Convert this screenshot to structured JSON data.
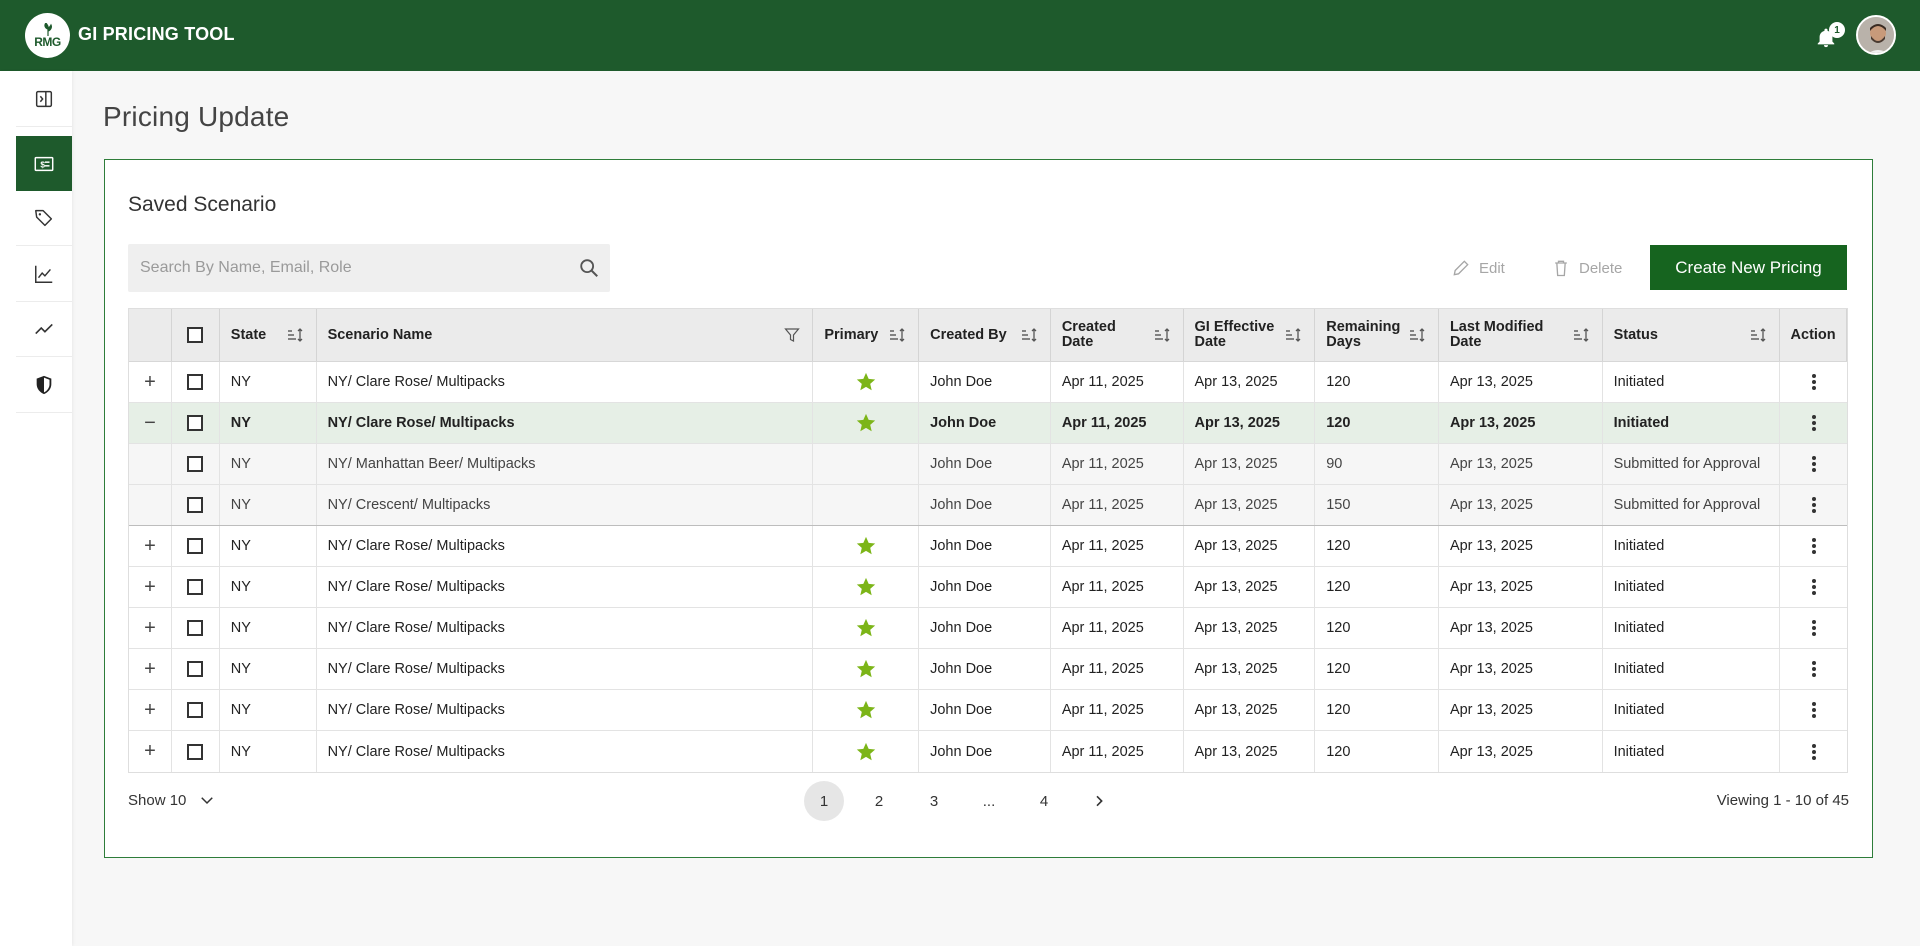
{
  "app": {
    "logo_text": "RMG",
    "title": "GI PRICING TOOL",
    "notification_count": "1"
  },
  "sidebar": {
    "items": [
      {
        "icon": "collapse-sidebar-icon",
        "active": false
      },
      {
        "icon": "pricing-icon",
        "active": true
      },
      {
        "icon": "tag-icon",
        "active": false
      },
      {
        "icon": "chart-icon",
        "active": false
      },
      {
        "icon": "trend-icon",
        "active": false
      },
      {
        "icon": "shield-icon",
        "active": false
      }
    ]
  },
  "page": {
    "title": "Pricing Update"
  },
  "panel": {
    "title": "Saved Scenario",
    "search_placeholder": "Search By Name, Email, Role",
    "edit_label": "Edit",
    "delete_label": "Delete",
    "create_label": "Create New Pricing"
  },
  "table": {
    "headers": {
      "state": "State",
      "scenario_name": "Scenario Name",
      "primary": "Primary",
      "created_by": "Created By",
      "created_date": "Created Date",
      "effective_date": "GI Effective Date",
      "remaining_days": "Remaining Days",
      "last_modified": "Last Modified Date",
      "status": "Status",
      "action": "Action"
    },
    "rows": [
      {
        "expander": "+",
        "kind": "parent",
        "state": "NY",
        "name": "NY/ Clare Rose/ Multipacks",
        "primary": true,
        "created_by": "John Doe",
        "created": "Apr 11, 2025",
        "effective": "Apr 13, 2025",
        "remaining": "120",
        "modified": "Apr 13, 2025",
        "status": "Initiated"
      },
      {
        "expander": "−",
        "kind": "expanded",
        "state": "NY",
        "name": "NY/ Clare Rose/ Multipacks",
        "primary": true,
        "created_by": "John Doe",
        "created": "Apr 11, 2025",
        "effective": "Apr 13, 2025",
        "remaining": "120",
        "modified": "Apr 13, 2025",
        "status": "Initiated"
      },
      {
        "expander": "",
        "kind": "child",
        "state": "NY",
        "name": "NY/ Manhattan Beer/ Multipacks",
        "primary": false,
        "created_by": "John Doe",
        "created": "Apr 11, 2025",
        "effective": "Apr 13, 2025",
        "remaining": "90",
        "modified": "Apr 13, 2025",
        "status": "Submitted for Approval"
      },
      {
        "expander": "",
        "kind": "child last",
        "state": "NY",
        "name": "NY/ Crescent/ Multipacks",
        "primary": false,
        "created_by": "John Doe",
        "created": "Apr 11, 2025",
        "effective": "Apr 13, 2025",
        "remaining": "150",
        "modified": "Apr 13, 2025",
        "status": "Submitted for Approval"
      },
      {
        "expander": "+",
        "kind": "parent",
        "state": "NY",
        "name": "NY/ Clare Rose/ Multipacks",
        "primary": true,
        "created_by": "John Doe",
        "created": "Apr 11, 2025",
        "effective": "Apr 13, 2025",
        "remaining": "120",
        "modified": "Apr 13, 2025",
        "status": "Initiated"
      },
      {
        "expander": "+",
        "kind": "parent",
        "state": "NY",
        "name": "NY/ Clare Rose/ Multipacks",
        "primary": true,
        "created_by": "John Doe",
        "created": "Apr 11, 2025",
        "effective": "Apr 13, 2025",
        "remaining": "120",
        "modified": "Apr 13, 2025",
        "status": "Initiated"
      },
      {
        "expander": "+",
        "kind": "parent",
        "state": "NY",
        "name": "NY/ Clare Rose/ Multipacks",
        "primary": true,
        "created_by": "John Doe",
        "created": "Apr 11, 2025",
        "effective": "Apr 13, 2025",
        "remaining": "120",
        "modified": "Apr 13, 2025",
        "status": "Initiated"
      },
      {
        "expander": "+",
        "kind": "parent",
        "state": "NY",
        "name": "NY/ Clare Rose/ Multipacks",
        "primary": true,
        "created_by": "John Doe",
        "created": "Apr 11, 2025",
        "effective": "Apr 13, 2025",
        "remaining": "120",
        "modified": "Apr 13, 2025",
        "status": "Initiated"
      },
      {
        "expander": "+",
        "kind": "parent",
        "state": "NY",
        "name": "NY/ Clare Rose/ Multipacks",
        "primary": true,
        "created_by": "John Doe",
        "created": "Apr 11, 2025",
        "effective": "Apr 13, 2025",
        "remaining": "120",
        "modified": "Apr 13, 2025",
        "status": "Initiated"
      },
      {
        "expander": "+",
        "kind": "parent",
        "state": "NY",
        "name": "NY/ Clare Rose/ Multipacks",
        "primary": true,
        "created_by": "John Doe",
        "created": "Apr 11, 2025",
        "effective": "Apr 13, 2025",
        "remaining": "120",
        "modified": "Apr 13, 2025",
        "status": "Initiated"
      }
    ]
  },
  "footer": {
    "show_label": "Show 10",
    "pages": [
      "1",
      "2",
      "3",
      "...",
      "4"
    ],
    "current_page": "1",
    "viewing": "Viewing 1 - 10 of 45"
  },
  "colors": {
    "brand": "#1e5a2c",
    "button": "#16641f",
    "star": "#7cb518",
    "expanded_row": "#e6efe6"
  }
}
